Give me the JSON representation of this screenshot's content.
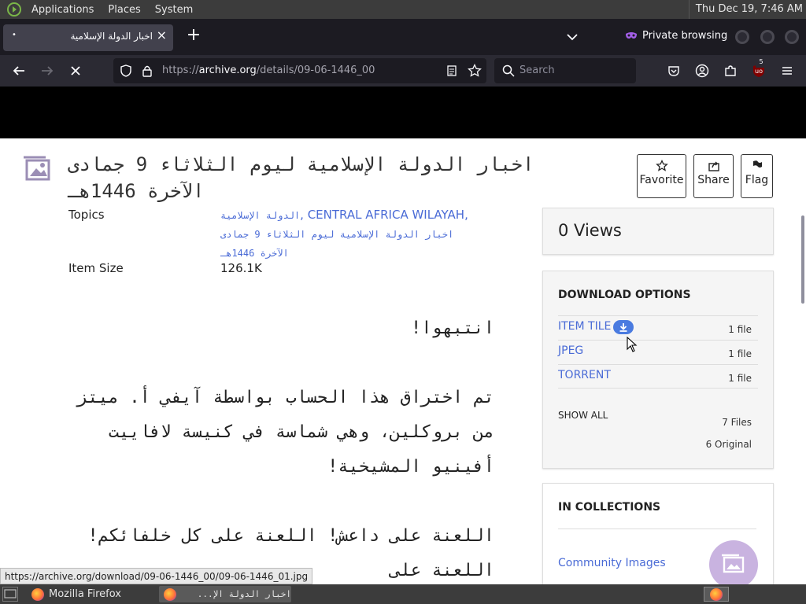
{
  "top_panel": {
    "menus": [
      "Applications",
      "Places",
      "System"
    ],
    "clock": "Thu Dec 19,  7:46 AM"
  },
  "browser": {
    "tab": {
      "title": "اخبار الدولة الإسلامية",
      "dot": "•",
      "close": "×"
    },
    "new_tab": "+",
    "private_label": "Private browsing",
    "url": {
      "scheme": "https://",
      "host": "archive.org",
      "path": "/details/09-06-1446_00"
    },
    "search_placeholder": "Search",
    "extension_badge": "5"
  },
  "item": {
    "title": "اخبار الدولة الإسلامية ليوم الثلاثاء 9 جمادى الآخرة 1446هـ",
    "actions": {
      "favorite": "Favorite",
      "share": "Share",
      "flag": "Flag"
    },
    "topics_label": "Topics",
    "topics": {
      "t1": "الدولة الإسلامية",
      "sep1": ", ",
      "t2": "CENTRAL AFRICA WILAYAH",
      "sep2": ", ",
      "t3": "اخبار الدولة الإسلامية ليوم الثلاثاء 9 جمادى الآخرة 1446هـ"
    },
    "item_size_label": "Item Size",
    "item_size": "126.1K",
    "description": [
      "انتبهوا!",
      "تم اختراق هذا الحساب بواسطة آيفي أ. ميتز من بروكلين، وهي شماسة في كنيسة لافاييت أفينيو المشيخية!",
      "اللعنة على داعش! اللعنة على كل خلفائكم! اللعنة على"
    ]
  },
  "sidebar": {
    "views": "0 Views",
    "download_options": {
      "heading": "DOWNLOAD OPTIONS",
      "rows": [
        {
          "format": "ITEM TILE",
          "count": "1 file"
        },
        {
          "format": "JPEG",
          "count": "1 file"
        },
        {
          "format": "TORRENT",
          "count": "1 file"
        }
      ],
      "show_all": "SHOW ALL",
      "files_total": "7 Files",
      "files_original": "6 Original"
    },
    "collections": {
      "heading": "IN COLLECTIONS",
      "items": [
        "Community Images"
      ]
    }
  },
  "status_url": "https://archive.org/download/09-06-1446_00/09-06-1446_01.jpg",
  "taskbar": {
    "items": [
      {
        "label": "Mozilla Firefox"
      },
      {
        "label": "اخبار الدولة الإ..."
      }
    ]
  },
  "colors": {
    "panel": "#3c3c3c",
    "firefox_toolbar": "#2b2a33",
    "firefox_tabbar": "#1c1b22",
    "link": "#4a6bd6",
    "private_purple": "#a35fe8"
  }
}
